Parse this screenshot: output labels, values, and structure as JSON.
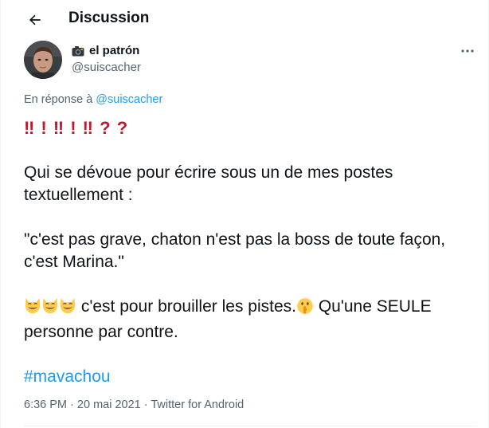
{
  "header": {
    "title": "Discussion",
    "back_icon": "arrow-left-icon"
  },
  "author": {
    "display_name": "el patrón",
    "handle": "@suiscacher",
    "name_emoji": "camera-with-flash-icon"
  },
  "reply": {
    "prefix": "En réponse à",
    "target": "@suiscacher"
  },
  "tweet": {
    "exclaim_line": "‼ ! ‼ ! ‼ ? ?",
    "para1": "Qui se dévoue pour écrire sous un de mes postes textuellement :",
    "para2": "\"c'est pas grave, chaton n'est pas la boss de toute façon, c'est Marina.\"",
    "para3_a": "c'est pour brouiller les pistes.",
    "para3_b": "Qu'une SEULE personne par contre.",
    "hashtag": "#mavachou"
  },
  "meta": {
    "time": "6:36 PM",
    "sep1": "·",
    "date": "20 mai 2021",
    "sep2": "·",
    "app": "Twitter for Android"
  },
  "colors": {
    "link": "#1d9bf0",
    "secondary_text": "#536471",
    "exclaim": "#be1931",
    "emoji": "#ffcc4d"
  }
}
